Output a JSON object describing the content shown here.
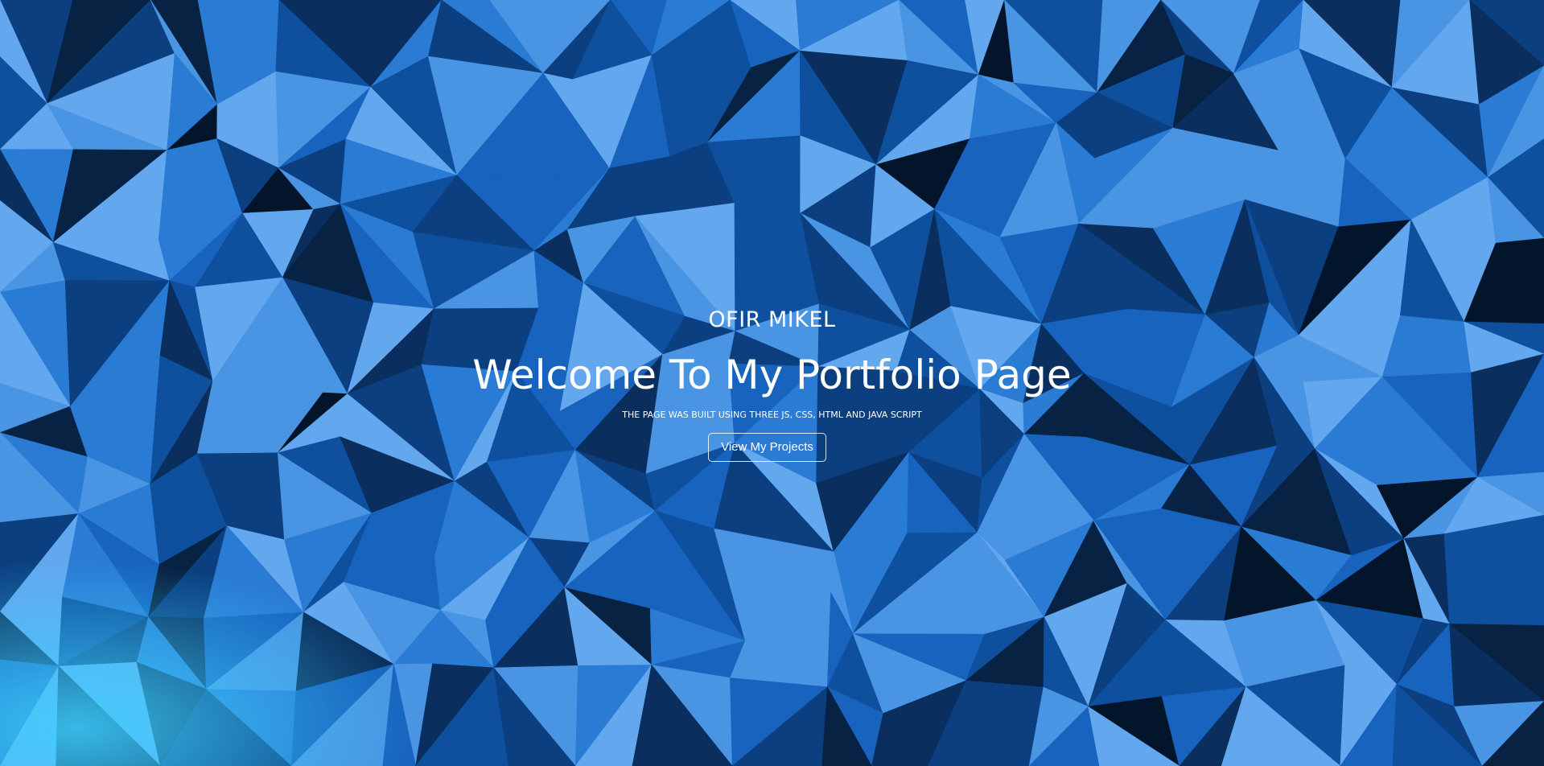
{
  "hero": {
    "name": "OFIR MIKEL",
    "title": "Welcome To My Portfolio Page",
    "subtitle": "THE PAGE WAS BUILT USING THREE JS, CSS, HTML AND JAVA SCRIPT",
    "button_label": "View My Projects"
  },
  "background": {
    "palette": [
      "#0a2f5e",
      "#0b3f80",
      "#0e4f9e",
      "#1763be",
      "#2a7bd4",
      "#4a95e3",
      "#63a7ee",
      "#072242",
      "#03152b"
    ],
    "glow_color": "#3fd2ff"
  }
}
